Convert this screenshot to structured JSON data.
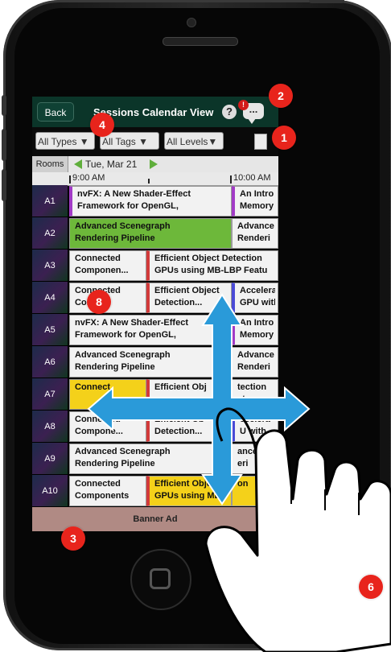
{
  "header": {
    "back_label": "Back",
    "title": "Sessions Calendar View",
    "help_label": "?",
    "chat_badge": "!",
    "chat_dots": "..."
  },
  "filters": {
    "types_label": "All Types ▼",
    "tags_label": "All Tags ▼",
    "levels_label": "All Levels▼"
  },
  "datebar": {
    "rooms_label": "Rooms",
    "date": "Tue, Mar 21"
  },
  "timebar": {
    "t1": "9:00 AM",
    "t2": "10:00 AM"
  },
  "rows": [
    {
      "room": "A1",
      "s1a": "nvFX: A New Shader-Effect",
      "s1b": "Framework for OpenGL,",
      "s2a": "An Intro",
      "s2b": "Memory"
    },
    {
      "room": "A2",
      "s1a": "Advanced Scenegraph",
      "s1b": "Rendering Pipeline",
      "s2a": "Advance",
      "s2b": "Renderi"
    },
    {
      "room": "A3",
      "s1a": "Connected",
      "s1b": "Componen...",
      "s2a": "Efficient Object Detection",
      "s2b": "GPUs using MB-LBP Featu"
    },
    {
      "room": "A4",
      "s1a": "Connected",
      "s1b": "Co...",
      "s2a": "Efficient Object",
      "s2b": "Detection...",
      "s3a": "Accelera",
      "s3b": "GPU with"
    },
    {
      "room": "A5",
      "s1a": "nvFX: A New Shader-Effect",
      "s1b": "Framework for OpenGL,",
      "s2a": "An Intro",
      "s2b": "Memory"
    },
    {
      "room": "A6",
      "s1a": "Advanced Scenegraph",
      "s1b": "Rendering Pipeline",
      "s2a": "Advance",
      "s2b": "Renderi"
    },
    {
      "room": "A7",
      "s1a": "Connect",
      "s1b": "",
      "s2a": "Efficient Obj",
      "s2b": "",
      "s3a": "tection",
      "s3b": "atu"
    },
    {
      "room": "A8",
      "s1a": "Connected",
      "s1b": "Compone...",
      "s2a": "Efficient Ob",
      "s2b": "Detection...",
      "s3a": "ccelera",
      "s3b": "U with"
    },
    {
      "room": "A9",
      "s1a": "Advanced Scenegraph",
      "s1b": "Rendering Pipeline",
      "s2a": "ance",
      "s2b": "eri"
    },
    {
      "room": "A10",
      "s1a": "Connected",
      "s1b": "Components",
      "s2a": "Efficient Objec",
      "s2b": "GPUs using MB",
      "s3a": "on",
      "s3b": ""
    }
  ],
  "banner": {
    "label": "Banner Ad"
  },
  "markers": {
    "m1": "1",
    "m2": "2",
    "m3": "3",
    "m4": "4",
    "m6": "6",
    "m8": "8"
  },
  "colors": {
    "header_green": "#0b3529",
    "accent_green": "#6db83a",
    "highlight_yellow": "#f4d11a",
    "marker_red": "#e8241c",
    "gesture_blue": "#2a9ad9",
    "banner": "#b08a84"
  },
  "icons": {
    "help": "question-icon",
    "chat": "chat-bubble-icon",
    "document": "document-icon",
    "nav_left": "green-left-arrow-icon",
    "nav_right": "green-right-arrow-icon",
    "gesture": "hand-pointer-icon",
    "pan": "four-way-arrows-icon"
  }
}
